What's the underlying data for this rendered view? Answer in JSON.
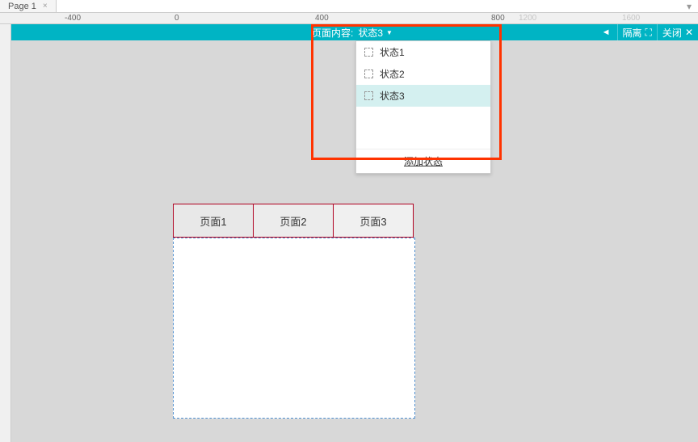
{
  "tabs": {
    "page1": "Page 1"
  },
  "ruler": {
    "m400": "-400",
    "zero": "0",
    "p400": "400",
    "p800": "800",
    "p1200": "1200",
    "p1600": "1600"
  },
  "header": {
    "pageContentLabel": "页面内容:",
    "currentState": "状态3",
    "backArrow": "◄",
    "isolate": "隔离",
    "close": "关闭"
  },
  "dropdown": {
    "items": [
      {
        "label": "状态1",
        "selected": false
      },
      {
        "label": "状态2",
        "selected": false
      },
      {
        "label": "状态3",
        "selected": true
      }
    ],
    "addState": "添加状态"
  },
  "pageTabs": [
    {
      "label": "页面1"
    },
    {
      "label": "页面2"
    },
    {
      "label": "页面3"
    }
  ]
}
